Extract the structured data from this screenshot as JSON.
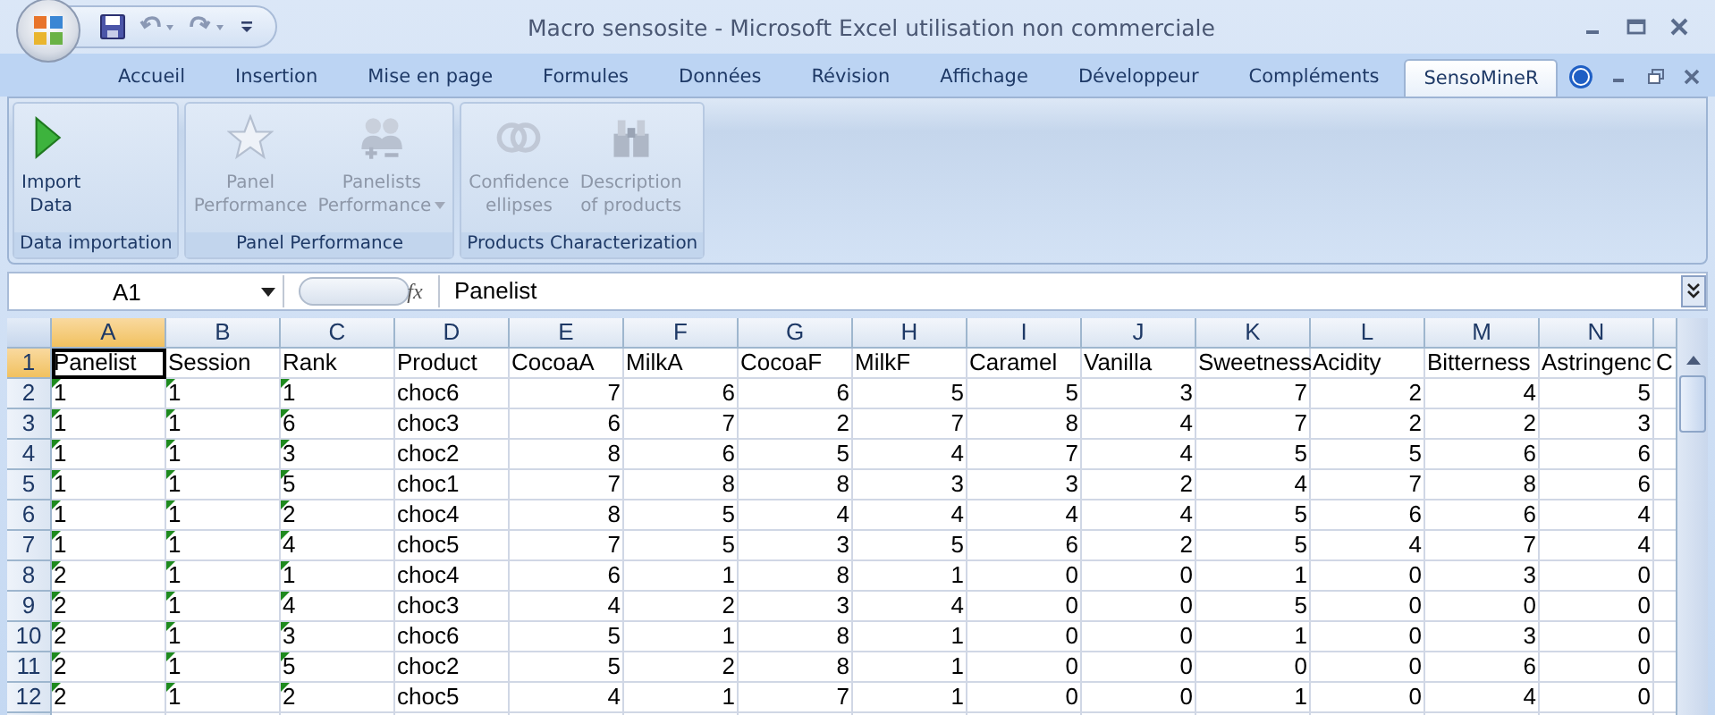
{
  "window": {
    "title": "Macro sensosite - Microsoft Excel utilisation non commerciale"
  },
  "tabs": [
    {
      "label": "Accueil",
      "selected": false
    },
    {
      "label": "Insertion",
      "selected": false
    },
    {
      "label": "Mise en page",
      "selected": false
    },
    {
      "label": "Formules",
      "selected": false
    },
    {
      "label": "Données",
      "selected": false
    },
    {
      "label": "Révision",
      "selected": false
    },
    {
      "label": "Affichage",
      "selected": false
    },
    {
      "label": "Développeur",
      "selected": false
    },
    {
      "label": "Compléments",
      "selected": false
    },
    {
      "label": "SensoMineR",
      "selected": true
    }
  ],
  "ribbon_groups": [
    {
      "label": "Data importation",
      "buttons": [
        {
          "lines": [
            "Import",
            "Data"
          ],
          "disabled": false,
          "dropdown": false
        }
      ]
    },
    {
      "label": "Panel Performance",
      "buttons": [
        {
          "lines": [
            "Panel",
            "Performance"
          ],
          "disabled": true,
          "dropdown": false
        },
        {
          "lines": [
            "Panelists",
            "Performance"
          ],
          "disabled": true,
          "dropdown": true
        }
      ]
    },
    {
      "label": "Products Characterization",
      "buttons": [
        {
          "lines": [
            "Confidence",
            "ellipses"
          ],
          "disabled": true,
          "dropdown": false
        },
        {
          "lines": [
            "Description",
            "of products"
          ],
          "disabled": true,
          "dropdown": false
        }
      ]
    }
  ],
  "formula_bar": {
    "name_box": "A1",
    "fx": "fx",
    "value": "Panelist"
  },
  "columns": [
    {
      "letter": "A",
      "kind": "number-as-text",
      "selected": true
    },
    {
      "letter": "B",
      "kind": "number-as-text",
      "selected": false
    },
    {
      "letter": "C",
      "kind": "number-as-text",
      "selected": false
    },
    {
      "letter": "D",
      "kind": "text",
      "selected": false
    },
    {
      "letter": "E",
      "kind": "number",
      "selected": false
    },
    {
      "letter": "F",
      "kind": "number",
      "selected": false
    },
    {
      "letter": "G",
      "kind": "number",
      "selected": false
    },
    {
      "letter": "H",
      "kind": "number",
      "selected": false
    },
    {
      "letter": "I",
      "kind": "number",
      "selected": false
    },
    {
      "letter": "J",
      "kind": "number",
      "selected": false
    },
    {
      "letter": "K",
      "kind": "number",
      "selected": false
    },
    {
      "letter": "L",
      "kind": "number",
      "selected": false
    },
    {
      "letter": "M",
      "kind": "number",
      "selected": false
    },
    {
      "letter": "N",
      "kind": "number",
      "selected": false
    },
    {
      "kind": "text",
      "selected": false
    }
  ],
  "rows": [
    {
      "number": "1",
      "selected": true,
      "cells": [
        "Panelist",
        "Session",
        "Rank",
        "Product",
        "CocoaA",
        "MilkA",
        "CocoaF",
        "MilkF",
        "Caramel",
        "Vanilla",
        "Sweetness",
        "Acidity",
        "Bitterness",
        "Astringenc",
        "C"
      ]
    },
    {
      "number": "2",
      "selected": false,
      "cells": [
        "1",
        "1",
        "1",
        "choc6",
        "7",
        "6",
        "6",
        "5",
        "5",
        "3",
        "7",
        "2",
        "4",
        "5"
      ]
    },
    {
      "number": "3",
      "selected": false,
      "cells": [
        "1",
        "1",
        "6",
        "choc3",
        "6",
        "7",
        "2",
        "7",
        "8",
        "4",
        "7",
        "2",
        "2",
        "3"
      ]
    },
    {
      "number": "4",
      "selected": false,
      "cells": [
        "1",
        "1",
        "3",
        "choc2",
        "8",
        "6",
        "5",
        "4",
        "7",
        "4",
        "5",
        "5",
        "6",
        "6"
      ]
    },
    {
      "number": "5",
      "selected": false,
      "cells": [
        "1",
        "1",
        "5",
        "choc1",
        "7",
        "8",
        "8",
        "3",
        "3",
        "2",
        "4",
        "7",
        "8",
        "6"
      ]
    },
    {
      "number": "6",
      "selected": false,
      "cells": [
        "1",
        "1",
        "2",
        "choc4",
        "8",
        "5",
        "4",
        "4",
        "4",
        "4",
        "5",
        "6",
        "6",
        "4"
      ]
    },
    {
      "number": "7",
      "selected": false,
      "cells": [
        "1",
        "1",
        "4",
        "choc5",
        "7",
        "5",
        "3",
        "5",
        "6",
        "2",
        "5",
        "4",
        "7",
        "4"
      ]
    },
    {
      "number": "8",
      "selected": false,
      "cells": [
        "2",
        "1",
        "1",
        "choc4",
        "6",
        "1",
        "8",
        "1",
        "0",
        "0",
        "1",
        "0",
        "3",
        "0"
      ]
    },
    {
      "number": "9",
      "selected": false,
      "cells": [
        "2",
        "1",
        "4",
        "choc3",
        "4",
        "2",
        "3",
        "4",
        "0",
        "0",
        "5",
        "0",
        "0",
        "0"
      ]
    },
    {
      "number": "10",
      "selected": false,
      "cells": [
        "2",
        "1",
        "3",
        "choc6",
        "5",
        "1",
        "8",
        "1",
        "0",
        "0",
        "1",
        "0",
        "3",
        "0"
      ]
    },
    {
      "number": "11",
      "selected": false,
      "cells": [
        "2",
        "1",
        "5",
        "choc2",
        "5",
        "2",
        "8",
        "1",
        "0",
        "0",
        "0",
        "0",
        "6",
        "0"
      ]
    },
    {
      "number": "12",
      "selected": false,
      "cells": [
        "2",
        "1",
        "2",
        "choc5",
        "4",
        "1",
        "7",
        "1",
        "0",
        "0",
        "1",
        "0",
        "4",
        "0"
      ]
    }
  ]
}
